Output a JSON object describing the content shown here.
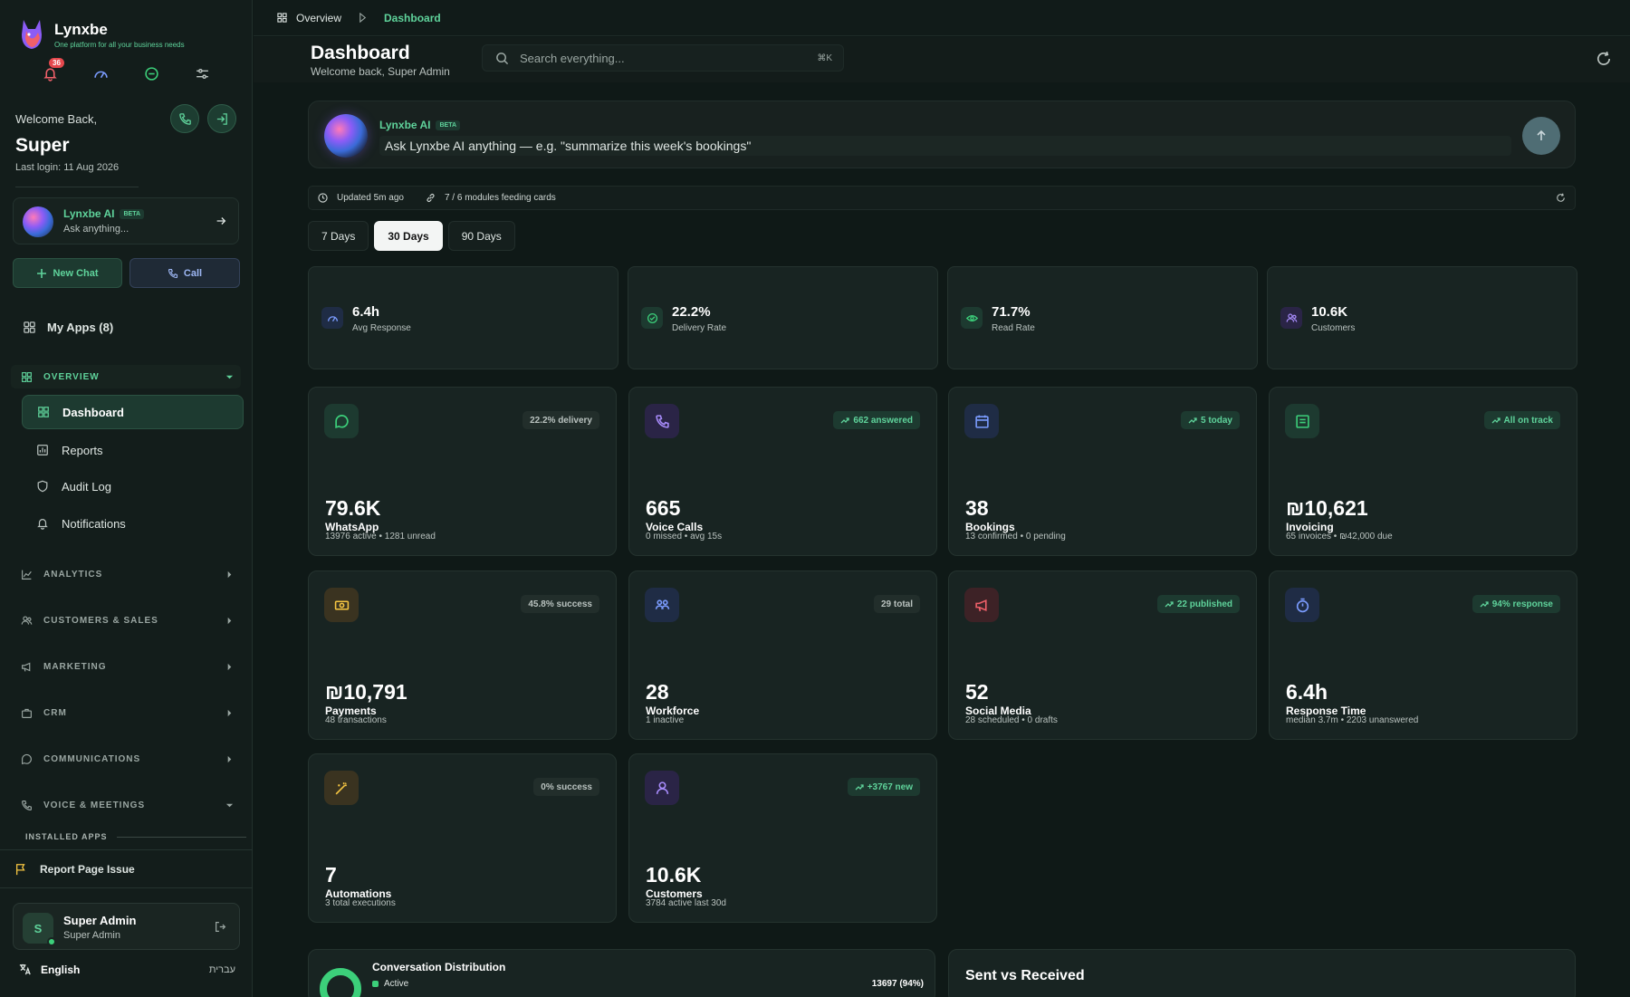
{
  "app": {
    "name": "Lynxbe",
    "tagline": "One platform for all your business needs",
    "notification_count": "36"
  },
  "sidebar": {
    "welcome": "Welcome Back,",
    "user_first": "Super",
    "last_login": "Last login: 11 Aug 2026",
    "ai": {
      "title": "Lynxbe AI",
      "beta": "BETA",
      "sub": "Ask anything..."
    },
    "new_chat": "New Chat",
    "call": "Call",
    "my_apps": "My Apps (8)",
    "sections": {
      "overview": "OVERVIEW",
      "analytics": "ANALYTICS",
      "customers": "CUSTOMERS & SALES",
      "marketing": "MARKETING",
      "crm": "CRM",
      "communications": "COMMUNICATIONS",
      "voice": "VOICE & MEETINGS"
    },
    "overview_items": [
      "Dashboard",
      "Reports",
      "Audit Log",
      "Notifications"
    ],
    "installed_apps": "INSTALLED APPS",
    "report_issue": "Report Page Issue",
    "user": {
      "initial": "S",
      "name": "Super Admin",
      "role": "Super Admin"
    },
    "language": "English",
    "language_alt": "עברית"
  },
  "breadcrumb": {
    "parent": "Overview",
    "current": "Dashboard"
  },
  "header": {
    "title": "Dashboard",
    "subtitle": "Welcome back, Super Admin",
    "search_placeholder": "Search everything...",
    "search_shortcut": "⌘K"
  },
  "ask_ai": {
    "title": "Lynxbe AI",
    "beta": "BETA",
    "placeholder": "Ask Lynxbe AI anything — e.g. \"summarize this week's bookings\""
  },
  "status": {
    "updated": "Updated 5m ago",
    "modules": "7 / 6 modules feeding cards"
  },
  "range_tabs": [
    "7 Days",
    "30 Days",
    "90 Days"
  ],
  "range_selected": "30 Days",
  "kpis": [
    {
      "value": "6.4h",
      "label": "Avg Response",
      "icon": "gauge-icon",
      "color": "#7b9cff"
    },
    {
      "value": "22.2%",
      "label": "Delivery Rate",
      "icon": "check-circle-icon",
      "color": "#3ccf7a"
    },
    {
      "value": "71.7%",
      "label": "Read Rate",
      "icon": "eye-icon",
      "color": "#3ccf7a"
    },
    {
      "value": "10.6K",
      "label": "Customers",
      "icon": "users-icon",
      "color": "#a78bfa"
    }
  ],
  "cards": [
    {
      "value": "79.6K",
      "label": "WhatsApp",
      "sub": "13976 active • 1281 unread",
      "badge": "22.2% delivery",
      "trend": false,
      "icon": "chat-bubble-icon",
      "color": "#3ccf7a"
    },
    {
      "value": "665",
      "label": "Voice Calls",
      "sub": "0 missed • avg 15s",
      "badge": "662 answered",
      "trend": true,
      "icon": "phone-icon",
      "color": "#a78bfa"
    },
    {
      "value": "38",
      "label": "Bookings",
      "sub": "13 confirmed • 0 pending",
      "badge": "5 today",
      "trend": true,
      "icon": "calendar-icon",
      "color": "#7b9cff"
    },
    {
      "value": "₪10,621",
      "label": "Invoicing",
      "sub": "65 invoices • ₪42,000 due",
      "badge": "All on track",
      "trend": true,
      "icon": "invoice-icon",
      "color": "#3ccf7a"
    },
    {
      "value": "₪10,791",
      "label": "Payments",
      "sub": "48 transactions",
      "badge": "45.8% success",
      "trend": false,
      "icon": "banknote-icon",
      "color": "#f5c542"
    },
    {
      "value": "28",
      "label": "Workforce",
      "sub": "1 inactive",
      "badge": "29 total",
      "trend": false,
      "icon": "team-icon",
      "color": "#7b9cff"
    },
    {
      "value": "52",
      "label": "Social Media",
      "sub": "28 scheduled • 0 drafts",
      "badge": "22 published",
      "trend": true,
      "icon": "megaphone-icon",
      "color": "#f0606a"
    },
    {
      "value": "6.4h",
      "label": "Response Time",
      "sub": "median 3.7m • 2203 unanswered",
      "badge": "94% response",
      "trend": true,
      "icon": "timer-icon",
      "color": "#7b9cff"
    },
    {
      "value": "7",
      "label": "Automations",
      "sub": "3 total executions",
      "badge": "0% success",
      "trend": false,
      "icon": "magic-wand-icon",
      "color": "#f5c542"
    },
    {
      "value": "10.6K",
      "label": "Customers",
      "sub": "3784 active last 30d",
      "badge": "+3767 new",
      "trend": true,
      "icon": "user-icon",
      "color": "#a78bfa"
    }
  ],
  "distribution": {
    "title": "Conversation Distribution",
    "legend_active": "Active",
    "active_value": "13697 (94%)"
  },
  "sent_received": {
    "title": "Sent vs Received"
  }
}
